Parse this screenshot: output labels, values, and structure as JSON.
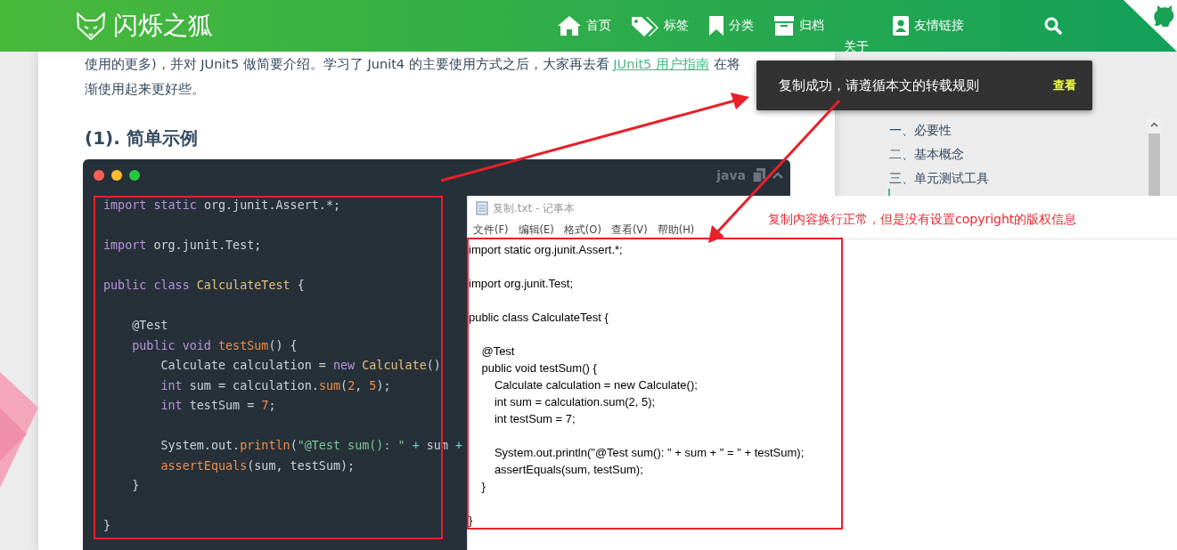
{
  "header": {
    "site_title": "闪烁之狐",
    "nav": [
      {
        "label": "首页"
      },
      {
        "label": "标签"
      },
      {
        "label": "分类"
      },
      {
        "label": "归档"
      },
      {
        "label": "关于"
      },
      {
        "label": "友情链接"
      }
    ]
  },
  "article": {
    "lines": [
      [
        {
          "kind": "text",
          "text": "使用的更多)，并对 JUnit5 做简要介绍。学习了 Junit4 的主要使用方式之后，大家再去看 "
        },
        {
          "kind": "link",
          "text": "JUnit5 用户指南"
        },
        {
          "kind": "text",
          "text": " 在将"
        }
      ],
      [
        {
          "kind": "text",
          "text": "渐使用起来更好些。"
        }
      ]
    ],
    "heading": "(1). 简单示例",
    "code_block": {
      "language": "java",
      "lines": [
        {
          "blank_before": false,
          "tokens": [
            {
              "kind": "keyword",
              "text": "import static "
            },
            {
              "kind": "plain",
              "text": "org.junit.Assert.*;"
            }
          ]
        },
        {
          "blank_before": true,
          "tokens": [
            {
              "kind": "keyword",
              "text": "import "
            },
            {
              "kind": "plain",
              "text": "org.junit.Test;"
            }
          ]
        },
        {
          "blank_before": true,
          "tokens": [
            {
              "kind": "keyword",
              "text": "public class "
            },
            {
              "kind": "type",
              "text": "CalculateTest"
            },
            {
              "kind": "plain",
              "text": " {"
            }
          ]
        },
        {
          "blank_before": true,
          "tokens": [
            {
              "kind": "plain",
              "text": "    @Test"
            }
          ]
        },
        {
          "blank_before": false,
          "tokens": [
            {
              "kind": "keyword",
              "text": "    public void "
            },
            {
              "kind": "function",
              "text": "testSum"
            },
            {
              "kind": "plain",
              "text": "() {"
            }
          ]
        },
        {
          "blank_before": false,
          "tokens": [
            {
              "kind": "plain",
              "text": "        Calculate calculation = "
            },
            {
              "kind": "keyword",
              "text": "new "
            },
            {
              "kind": "type",
              "text": "Calculate"
            },
            {
              "kind": "plain",
              "text": "()"
            }
          ]
        },
        {
          "blank_before": false,
          "tokens": [
            {
              "kind": "keyword",
              "text": "        int"
            },
            {
              "kind": "plain",
              "text": " sum = calculation."
            },
            {
              "kind": "function",
              "text": "sum"
            },
            {
              "kind": "plain",
              "text": "("
            },
            {
              "kind": "number",
              "text": "2"
            },
            {
              "kind": "plain",
              "text": ", "
            },
            {
              "kind": "number",
              "text": "5"
            },
            {
              "kind": "plain",
              "text": ");"
            }
          ]
        },
        {
          "blank_before": false,
          "tokens": [
            {
              "kind": "keyword",
              "text": "        int"
            },
            {
              "kind": "plain",
              "text": " testSum = "
            },
            {
              "kind": "number",
              "text": "7"
            },
            {
              "kind": "plain",
              "text": ";"
            }
          ]
        },
        {
          "blank_before": true,
          "tokens": [
            {
              "kind": "plain",
              "text": "        System.out."
            },
            {
              "kind": "function",
              "text": "println"
            },
            {
              "kind": "plain",
              "text": "("
            },
            {
              "kind": "string",
              "text": "\"@Test sum(): \""
            },
            {
              "kind": "operator",
              "text": " +"
            },
            {
              "kind": "plain",
              "text": " sum"
            },
            {
              "kind": "operator",
              "text": " +"
            }
          ]
        },
        {
          "blank_before": false,
          "tokens": [
            {
              "kind": "function",
              "text": "        assertEquals"
            },
            {
              "kind": "plain",
              "text": "(sum, testSum);"
            }
          ]
        },
        {
          "blank_before": false,
          "tokens": [
            {
              "kind": "plain",
              "text": "    }"
            }
          ]
        },
        {
          "blank_before": true,
          "tokens": [
            {
              "kind": "plain",
              "text": "}"
            }
          ]
        }
      ]
    }
  },
  "toc": [
    {
      "label": "一、必要性"
    },
    {
      "label": "二、基本概念"
    },
    {
      "label": "三、单元测试工具"
    }
  ],
  "toast": {
    "message": "复制成功，请遵循本文的转载规则",
    "action": "查看"
  },
  "notepad": {
    "title": "复制.txt - 记事本",
    "menu": [
      "文件(F)",
      "编辑(E)",
      "格式(O)",
      "查看(V)",
      "帮助(H)"
    ],
    "lines": [
      {
        "blank_before": false,
        "text": "import static org.junit.Assert.*;"
      },
      {
        "blank_before": true,
        "text": "import org.junit.Test;"
      },
      {
        "blank_before": true,
        "text": "public class CalculateTest {"
      },
      {
        "blank_before": true,
        "text": "    @Test"
      },
      {
        "blank_before": false,
        "text": "    public void testSum() {"
      },
      {
        "blank_before": false,
        "text": "        Calculate calculation = new Calculate();"
      },
      {
        "blank_before": false,
        "text": "        int sum = calculation.sum(2, 5);"
      },
      {
        "blank_before": false,
        "text": "        int testSum = 7;"
      },
      {
        "blank_before": true,
        "text": "        System.out.println(\"@Test sum(): \" + sum + \" = \" + testSum);"
      },
      {
        "blank_before": false,
        "text": "        assertEquals(sum, testSum);"
      },
      {
        "blank_before": false,
        "text": "    }"
      },
      {
        "blank_before": true,
        "text": "}"
      }
    ]
  },
  "annotation": {
    "note": "复制内容换行正常，但是没有设置copyright的版权信息"
  }
}
